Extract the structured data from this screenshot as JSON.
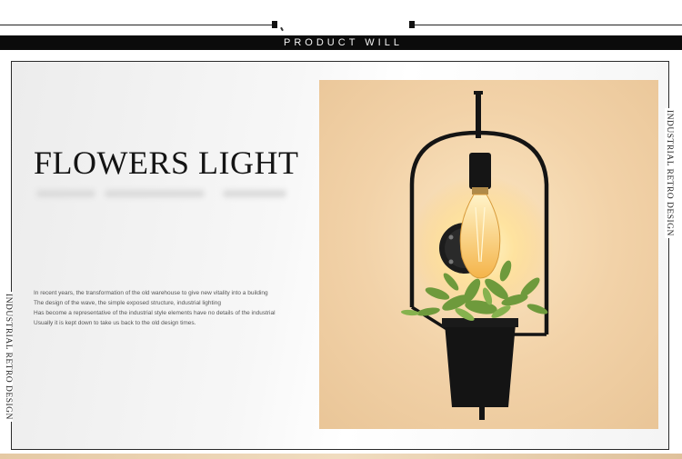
{
  "header": {
    "title": "PRODUCT WILL"
  },
  "hero": {
    "heading": "FLOWERS LIGHT",
    "body_lines": [
      "In recent years, the transformation of the old warehouse to give new vitality into a building",
      "The design of the wave, the simple exposed structure, industrial lighting",
      "Has become a representative of the industrial style elements have no details of the industrial",
      "Usually it is kept down to take us back to the old design times."
    ]
  },
  "side_labels": {
    "right": "INDUSTRIAL RETRO DESIGN",
    "left": "INDUSTRIAL RETRO DESIGN"
  },
  "colors": {
    "band": "#0b0b0b",
    "wall": "#f2d2a8",
    "metal": "#141414",
    "bulb": "#ffd77a",
    "leaves": "#6e9a3c"
  },
  "icons": {
    "product_image": "wall-lamp-with-plant-pot"
  }
}
